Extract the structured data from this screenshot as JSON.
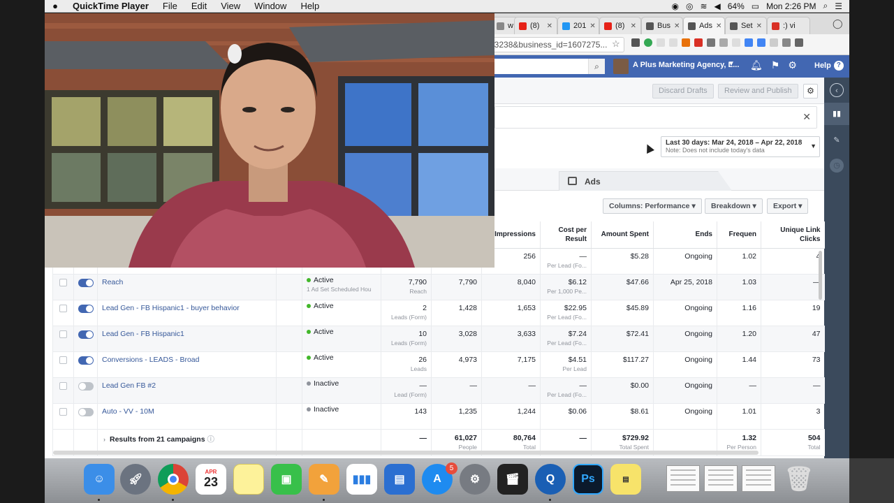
{
  "menubar": {
    "app_name": "QuickTime Player",
    "menus": [
      "File",
      "Edit",
      "View",
      "Window",
      "Help"
    ],
    "battery": "64%",
    "clock": "Mon 2:26 PM"
  },
  "browser": {
    "tabs": [
      {
        "label": "w",
        "color": "#888888"
      },
      {
        "label": "(8)",
        "color": "#e62117"
      },
      {
        "label": "201",
        "color": "#2196f3"
      },
      {
        "label": "(8)",
        "color": "#e62117"
      },
      {
        "label": "Bus",
        "color": "#555555"
      },
      {
        "label": "Ads",
        "color": "#555555"
      },
      {
        "label": "Set",
        "color": "#555555"
      },
      {
        "label": ":) vi",
        "color": "#d93025"
      }
    ],
    "url": "33238&business_id=1607275..."
  },
  "fb_header": {
    "account": "A Plus Marketing Agency, L...",
    "help_label": "Help"
  },
  "toolbar": {
    "discard_drafts": "Discard Drafts",
    "review_publish": "Review and Publish"
  },
  "date_range": {
    "label": "Last 30 days: Mar 24, 2018 – Apr 22, 2018",
    "note": "Note: Does not include today's data"
  },
  "level_tabs": {
    "ads_label": "Ads"
  },
  "table_tools": {
    "columns": "Columns: Performance",
    "breakdown": "Breakdown",
    "export": "Export"
  },
  "table": {
    "headers": {
      "impressions": "Impressions",
      "cost_per_result": "Cost per Result",
      "amount_spent": "Amount Spent",
      "ends": "Ends",
      "frequency": "Frequen",
      "unique_link_clicks": "Unique Link Clicks"
    },
    "rows": [
      {
        "name": "",
        "on": true,
        "delivery": "",
        "delivery_sub": "",
        "results": "",
        "results_sub": "",
        "reach": "",
        "impressions": "256",
        "cpr": "—",
        "cpr_sub": "Per Lead (Fo...",
        "spent": "$5.28",
        "ends": "Ongoing",
        "freq": "1.02",
        "clicks": "4"
      },
      {
        "name": "Reach",
        "on": true,
        "delivery": "Active",
        "delivery_sub": "1 Ad Set Scheduled Hou",
        "results": "7,790",
        "results_sub": "Reach",
        "reach": "7,790",
        "impressions": "8,040",
        "cpr": "$6.12",
        "cpr_sub": "Per 1,000 Pe...",
        "spent": "$47.66",
        "ends": "Apr 25, 2018",
        "freq": "1.03",
        "clicks": "—"
      },
      {
        "name": "Lead Gen - FB Hispanic1 - buyer behavior",
        "on": true,
        "delivery": "Active",
        "delivery_sub": "",
        "results": "2",
        "results_sub": "Leads (Form)",
        "reach": "1,428",
        "impressions": "1,653",
        "cpr": "$22.95",
        "cpr_sub": "Per Lead (Fo...",
        "spent": "$45.89",
        "ends": "Ongoing",
        "freq": "1.16",
        "clicks": "19"
      },
      {
        "name": "Lead Gen - FB Hispanic1",
        "on": true,
        "delivery": "Active",
        "delivery_sub": "",
        "results": "10",
        "results_sub": "Leads (Form)",
        "reach": "3,028",
        "impressions": "3,633",
        "cpr": "$7.24",
        "cpr_sub": "Per Lead (Fo...",
        "spent": "$72.41",
        "ends": "Ongoing",
        "freq": "1.20",
        "clicks": "47"
      },
      {
        "name": "Conversions - LEADS - Broad",
        "on": true,
        "delivery": "Active",
        "delivery_sub": "",
        "results": "26",
        "results_sub": "Leads",
        "reach": "4,973",
        "impressions": "7,175",
        "cpr": "$4.51",
        "cpr_sub": "Per Lead",
        "spent": "$117.27",
        "ends": "Ongoing",
        "freq": "1.44",
        "clicks": "73"
      },
      {
        "name": "Lead Gen FB #2",
        "on": false,
        "delivery": "Inactive",
        "delivery_sub": "",
        "results": "—",
        "results_sub": "Lead (Form)",
        "reach": "—",
        "impressions": "—",
        "cpr": "—",
        "cpr_sub": "Per Lead (Fo...",
        "spent": "$0.00",
        "ends": "Ongoing",
        "freq": "—",
        "clicks": "—"
      },
      {
        "name": "Auto - VV - 10M",
        "on": false,
        "delivery": "Inactive",
        "delivery_sub": "",
        "results": "143",
        "results_sub": "",
        "reach": "1,235",
        "impressions": "1,244",
        "cpr": "$0.06",
        "cpr_sub": "",
        "spent": "$8.61",
        "ends": "Ongoing",
        "freq": "1.01",
        "clicks": "3"
      }
    ],
    "footer": {
      "label": "Results from 21 campaigns",
      "results": "—",
      "reach": "61,027",
      "reach_sub": "People",
      "impressions": "80,764",
      "impressions_sub": "Total",
      "cpr": "—",
      "spent": "$729.92",
      "spent_sub": "Total Spent",
      "freq": "1.32",
      "freq_sub": "Per Person",
      "clicks": "504",
      "clicks_sub": "Total"
    }
  },
  "dock": {
    "calendar_month": "APR",
    "calendar_day": "23",
    "appstore_badge": "5",
    "photoshop_label": "Ps"
  }
}
